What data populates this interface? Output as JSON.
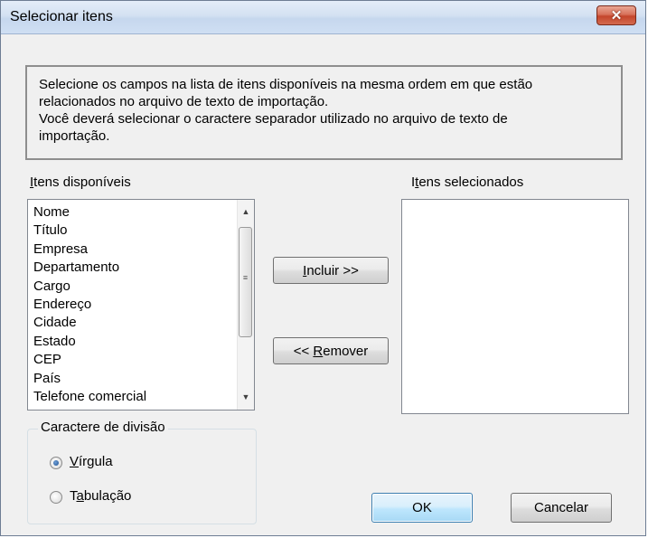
{
  "window": {
    "title": "Selecionar itens",
    "close_glyph": "✕"
  },
  "info": {
    "line1": "Selecione os campos na lista de itens disponíveis na mesma ordem em que estão",
    "line2": "relacionados no arquivo de texto de importação.",
    "line3": "Você deverá selecionar o caractere separador utilizado no arquivo de texto de",
    "line4": "importação."
  },
  "available": {
    "label_mnemonic": "I",
    "label_rest": "tens disponíveis",
    "items": [
      "Nome",
      "Título",
      "Empresa",
      "Departamento",
      "Cargo",
      "Endereço",
      "Cidade",
      "Estado",
      "CEP",
      "País",
      "Telefone comercial"
    ]
  },
  "selected": {
    "label_pre": "I",
    "label_mnemonic": "t",
    "label_rest": "ens selecionados",
    "items": []
  },
  "buttons": {
    "include_mnemonic": "I",
    "include_rest": "ncluir >>",
    "remove_pre": "<< ",
    "remove_mnemonic": "R",
    "remove_rest": "emover",
    "ok": "OK",
    "cancel": "Cancelar"
  },
  "separator": {
    "legend": "Caractere de divisão",
    "options": [
      {
        "mnemonic": "V",
        "rest": "írgula",
        "checked": true
      },
      {
        "pre": "T",
        "mnemonic": "a",
        "rest": "bulação",
        "checked": false
      }
    ]
  },
  "colors": {
    "close_button": "#c4452b",
    "default_button_border": "#3c7fb1",
    "radio_dot": "#1d4f8f"
  }
}
